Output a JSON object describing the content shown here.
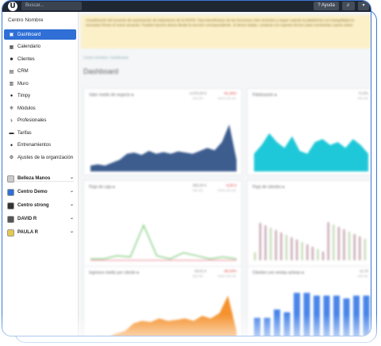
{
  "topbar": {
    "logo": "Ü",
    "search_placeholder": "Buscar...",
    "help_label": "? Ayuda",
    "sound_icon": "speaker-icon",
    "more_label": "▾"
  },
  "sidebar": {
    "brand": "Centro Nombre",
    "items": [
      {
        "label": "Dashboard",
        "icon": "▣",
        "active": true
      },
      {
        "label": "Calendario",
        "icon": "▦"
      },
      {
        "label": "Clientes",
        "icon": "☻"
      },
      {
        "label": "CRM",
        "icon": "▤"
      },
      {
        "label": "Muro",
        "icon": "▥"
      },
      {
        "label": "Timpy",
        "icon": "●"
      },
      {
        "label": "Módulos",
        "icon": "❈"
      },
      {
        "label": "Profesionales",
        "icon": "⚕"
      },
      {
        "label": "Tarifas",
        "icon": "▬"
      },
      {
        "label": "Entrenamientos",
        "icon": "✦"
      },
      {
        "label": "Ajustes de la organización",
        "icon": "⚙"
      }
    ],
    "centers": [
      {
        "label": "Belleza Manos",
        "color": "#cccccc"
      },
      {
        "label": "Centro Demo",
        "color": "#2f6fd6"
      },
      {
        "label": "Centro strong",
        "color": "#333333"
      },
      {
        "label": "DAVID R",
        "color": "#555555"
      },
      {
        "label": "PAULA R",
        "color": "#e8c84a"
      }
    ]
  },
  "main": {
    "alert": "Actualización del acuerdo de autorización de tratamiento de la RGPD. Para beneficiarse de las funciones más recientes y seguir usando la plataforma con tranquilidad es necesario firmar el nuevo acuerdo. Puedes hacerlo ahora desde la sección correspondiente. Si tienes dudas, contacta con soporte técnico para resolverlas cuanto antes.",
    "breadcrumb": "Centro Nombre / Dashboard",
    "title": "Dashboard"
  },
  "cards": [
    {
      "title": "Valor medio de negocio ●",
      "value1": "4.073,40 €",
      "value2": "-91,20%",
      "sub1": "este año",
      "sub2": "mismo año ant."
    },
    {
      "title": "Fidelización ●",
      "value1": "71,5%",
      "value2": "",
      "sub1": "",
      "sub2": "este año"
    },
    {
      "title": "Flujo de caja ●",
      "value1": "355,00 €",
      "value2": "-5,00 €",
      "sub1": "este año",
      "sub2": "mismo año ant."
    },
    {
      "title": "Flujo de clientes ●",
      "value1": "",
      "value2": "",
      "sub1": "",
      "sub2": ""
    },
    {
      "title": "Ingresos medio por cliente ●",
      "value1": "33,01 €",
      "value2": "-90,33%",
      "sub1": "este año",
      "sub2": "mismo año ant."
    },
    {
      "title": "Clientes con ventas activas ●",
      "value1": "11,70",
      "value2": "",
      "sub1": "",
      "sub2": "este año"
    }
  ],
  "colors": {
    "accent": "#2f6fd6",
    "topbar": "#1f2733",
    "chart_navy": "#3d5d8f",
    "chart_cyan": "#1fc8d8",
    "chart_orange": "#f5922e",
    "chart_green": "#8fd18a",
    "chart_blue": "#4a86e8"
  }
}
